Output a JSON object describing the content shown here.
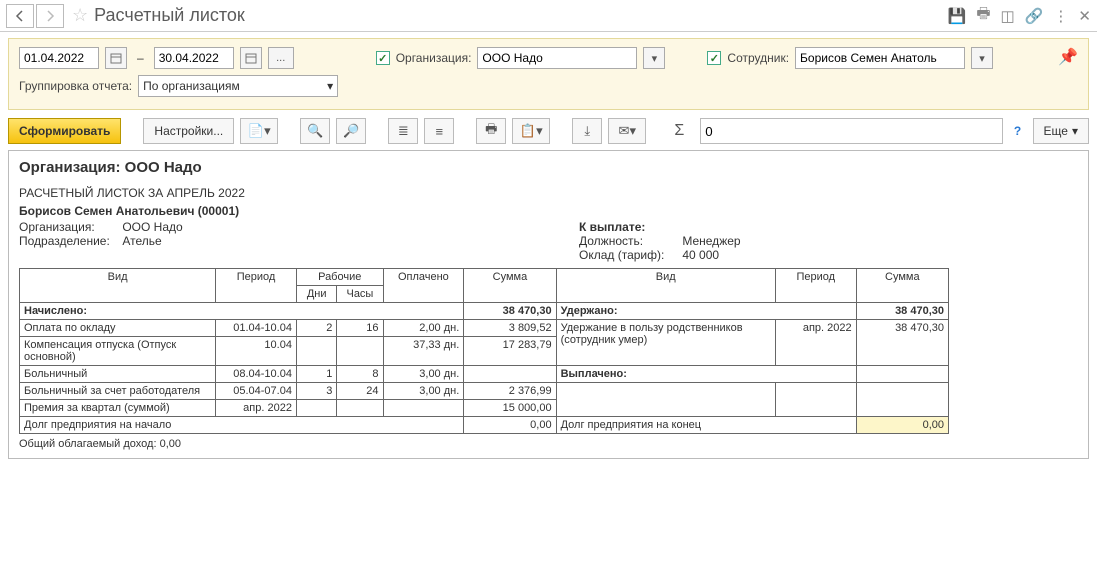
{
  "title": "Расчетный листок",
  "filters": {
    "date_from": "01.04.2022",
    "date_to": "30.04.2022",
    "org_label": "Организация:",
    "org_value": "ООО Надо",
    "emp_label": "Сотрудник:",
    "emp_value": "Борисов Семен Анатоль",
    "group_label": "Группировка отчета:",
    "group_value": "По организациям",
    "dash": "–"
  },
  "toolbar": {
    "form_btn": "Сформировать",
    "settings_btn": "Настройки...",
    "sum_value": "0",
    "more_btn": "Еще"
  },
  "report": {
    "org_title": "Организация: ООО Надо",
    "sheet_caption": "РАСЧЕТНЫЙ ЛИСТОК ЗА АПРЕЛЬ 2022",
    "employee_name": "Борисов Семен Анатольевич (00001)",
    "left_org_lbl": "Организация:",
    "left_org_val": "ООО Надо",
    "left_dep_lbl": "Подразделение:",
    "left_dep_val": "Ателье",
    "right_pay_lbl": "К выплате:",
    "right_pos_lbl": "Должность:",
    "right_pos_val": "Менеджер",
    "right_rate_lbl": "Оклад (тариф):",
    "right_rate_val": "40 000",
    "headers": {
      "vid": "Вид",
      "period": "Период",
      "work": "Рабочие",
      "days": "Дни",
      "hours": "Часы",
      "paid": "Оплачено",
      "sum": "Сумма"
    },
    "accrued_label": "Начислено:",
    "accrued_total": "38 470,30",
    "withheld_label": "Удержано:",
    "withheld_total": "38 470,30",
    "paid_label": "Выплачено:",
    "accrued_rows": [
      {
        "name": "Оплата по окладу",
        "period": "01.04-10.04",
        "days": "2",
        "hours": "16",
        "paid": "2,00 дн.",
        "sum": "3 809,52"
      },
      {
        "name": "Компенсация отпуска (Отпуск основной)",
        "period": "10.04",
        "days": "",
        "hours": "",
        "paid": "37,33 дн.",
        "sum": "17 283,79"
      },
      {
        "name": "Больничный",
        "period": "08.04-10.04",
        "days": "1",
        "hours": "8",
        "paid": "3,00 дн.",
        "sum": ""
      },
      {
        "name": "Больничный за счет работодателя",
        "period": "05.04-07.04",
        "days": "3",
        "hours": "24",
        "paid": "3,00 дн.",
        "sum": "2 376,99"
      },
      {
        "name": "Премия за квартал (суммой)",
        "period": "апр. 2022",
        "days": "",
        "hours": "",
        "paid": "",
        "sum": "15 000,00"
      }
    ],
    "withheld_rows": [
      {
        "name": "Удержание в пользу родственников (сотрудник умер)",
        "period": "апр. 2022",
        "sum": "38 470,30"
      }
    ],
    "debt_start_lbl": "Долг предприятия на начало",
    "debt_start_val": "0,00",
    "debt_end_lbl": "Долг предприятия на конец",
    "debt_end_val": "0,00",
    "taxable_line": "Общий облагаемый доход: 0,00"
  }
}
